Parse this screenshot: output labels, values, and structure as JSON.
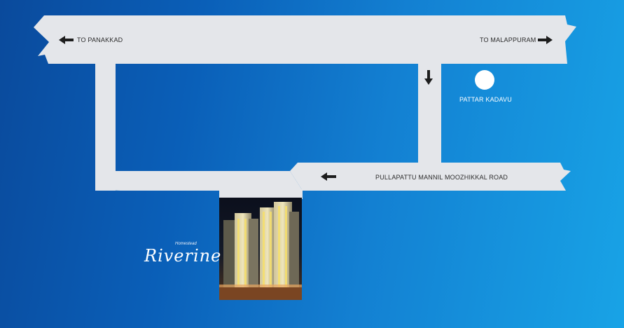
{
  "labels": {
    "west_destination": "TO PANAKKAD",
    "east_destination": "TO MALAPPURAM",
    "landmark": "PATTAR KADAVU",
    "road_name": "PULLAPATTU MANNIL MOOZHIKKAL ROAD"
  },
  "logo": {
    "tagline": "Homestead",
    "name": "Riverine"
  },
  "colors": {
    "road": "#e4e6ea",
    "arrow": "#1d1d1d",
    "background_dark": "#0a4a9c",
    "background_light": "#18a3e6",
    "landmark_marker": "#ffffff"
  },
  "icons": [
    "arrow-left-icon",
    "arrow-right-icon",
    "arrow-down-icon",
    "landmark-circle-icon"
  ]
}
